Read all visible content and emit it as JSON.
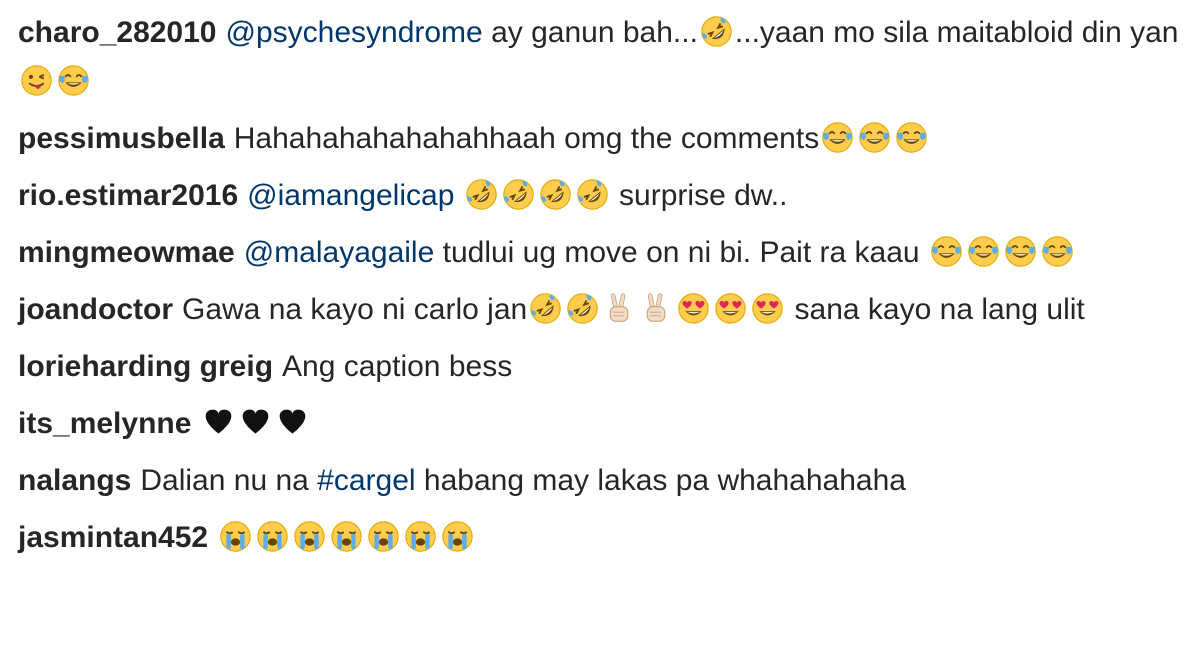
{
  "colors": {
    "username": "#262626",
    "text": "#262626",
    "link": "#00376b",
    "emoji_face": "#ffcc4d",
    "emoji_outline": "#e0a800",
    "emoji_tear": "#5dadec",
    "emoji_heart": "#e0245e",
    "black_heart": "#111111"
  },
  "comments": [
    {
      "username": "charo_282010",
      "parts": [
        {
          "type": "mention",
          "text": "@psychesyndrome"
        },
        {
          "type": "text",
          "text": " ay ganun bah..."
        },
        {
          "type": "emoji",
          "icon": "rofl-icon"
        },
        {
          "type": "text",
          "text": "...yaan mo sila maitabloid din yan "
        },
        {
          "type": "emoji",
          "icon": "winking-tongue-icon"
        },
        {
          "type": "emoji",
          "icon": "tears-of-joy-icon"
        }
      ]
    },
    {
      "username": "pessimusbella",
      "parts": [
        {
          "type": "text",
          "text": "Hahahahahahahahhaah omg the comments"
        },
        {
          "type": "emoji",
          "icon": "tears-of-joy-icon"
        },
        {
          "type": "emoji",
          "icon": "tears-of-joy-icon"
        },
        {
          "type": "emoji",
          "icon": "tears-of-joy-icon"
        }
      ]
    },
    {
      "username": "rio.estimar2016",
      "parts": [
        {
          "type": "mention",
          "text": "@iamangelicap"
        },
        {
          "type": "text",
          "text": " "
        },
        {
          "type": "emoji",
          "icon": "rofl-icon"
        },
        {
          "type": "emoji",
          "icon": "rofl-icon"
        },
        {
          "type": "emoji",
          "icon": "rofl-icon"
        },
        {
          "type": "emoji",
          "icon": "rofl-icon"
        },
        {
          "type": "text",
          "text": " surprise dw.."
        }
      ]
    },
    {
      "username": "mingmeowmae",
      "parts": [
        {
          "type": "mention",
          "text": "@malayagaile"
        },
        {
          "type": "text",
          "text": " tudlui ug move on ni bi. Pait ra kaau "
        },
        {
          "type": "emoji",
          "icon": "tears-of-joy-icon"
        },
        {
          "type": "emoji",
          "icon": "tears-of-joy-icon"
        },
        {
          "type": "emoji",
          "icon": "tears-of-joy-icon"
        },
        {
          "type": "emoji",
          "icon": "tears-of-joy-icon"
        }
      ]
    },
    {
      "username": "joandoctor",
      "parts": [
        {
          "type": "text",
          "text": "Gawa na kayo ni carlo jan"
        },
        {
          "type": "emoji",
          "icon": "rofl-icon"
        },
        {
          "type": "emoji",
          "icon": "rofl-icon"
        },
        {
          "type": "emoji",
          "icon": "victory-hand-icon"
        },
        {
          "type": "emoji",
          "icon": "victory-hand-icon"
        },
        {
          "type": "emoji",
          "icon": "heart-eyes-icon"
        },
        {
          "type": "emoji",
          "icon": "heart-eyes-icon"
        },
        {
          "type": "emoji",
          "icon": "heart-eyes-icon"
        },
        {
          "type": "text",
          "text": " sana kayo na lang ulit"
        }
      ]
    },
    {
      "username": "lorieharding greig",
      "parts": [
        {
          "type": "text",
          "text": "Ang caption bess"
        }
      ]
    },
    {
      "username": "its_melynne",
      "parts": [
        {
          "type": "text",
          "text": ""
        },
        {
          "type": "emoji",
          "icon": "black-heart-icon"
        },
        {
          "type": "emoji",
          "icon": "black-heart-icon"
        },
        {
          "type": "emoji",
          "icon": "black-heart-icon"
        }
      ]
    },
    {
      "username": "nalangs",
      "parts": [
        {
          "type": "text",
          "text": "Dalian nu na "
        },
        {
          "type": "hashtag",
          "text": "#cargel"
        },
        {
          "type": "text",
          "text": " habang may lakas pa whahahahaha"
        }
      ]
    },
    {
      "username": "jasmintan452",
      "parts": [
        {
          "type": "emoji",
          "icon": "loudly-crying-icon"
        },
        {
          "type": "emoji",
          "icon": "loudly-crying-icon"
        },
        {
          "type": "emoji",
          "icon": "loudly-crying-icon"
        },
        {
          "type": "emoji",
          "icon": "loudly-crying-icon"
        },
        {
          "type": "emoji",
          "icon": "loudly-crying-icon"
        },
        {
          "type": "emoji",
          "icon": "loudly-crying-icon"
        },
        {
          "type": "emoji",
          "icon": "loudly-crying-icon"
        }
      ]
    }
  ]
}
